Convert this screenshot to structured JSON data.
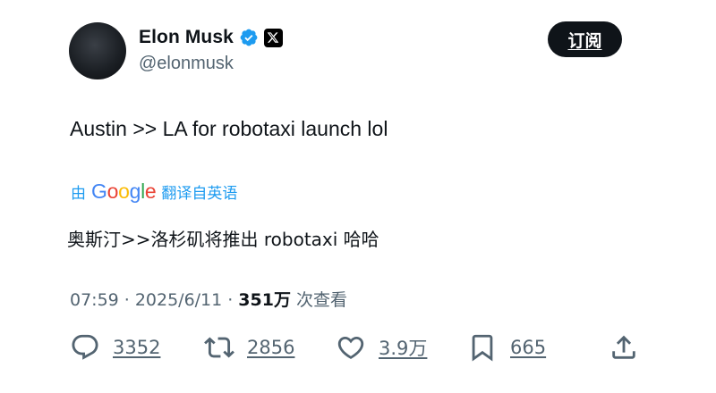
{
  "author": {
    "display_name": "Elon Musk",
    "handle": "@elonmusk",
    "verified_icon": "verified-badge-icon",
    "affiliate_icon": "x-logo-icon"
  },
  "header": {
    "subscribe_label": "订阅"
  },
  "tweet": {
    "text": "Austin >> LA for robotaxi launch lol"
  },
  "translation": {
    "prefix": "由",
    "provider_letters": [
      "G",
      "o",
      "o",
      "g",
      "l",
      "e"
    ],
    "suffix": "翻译自英语",
    "text": "奥斯汀>>洛杉矶将推出 robotaxi 哈哈"
  },
  "meta": {
    "time": "07:59",
    "separator": "·",
    "date": "2025/6/11",
    "separator2": "·",
    "views_count": "351万",
    "views_label": "次查看"
  },
  "actions": {
    "replies": "3352",
    "retweets": "2856",
    "likes": "3.9万",
    "bookmarks": "665"
  },
  "colors": {
    "text": "#0f1419",
    "secondary": "#536471",
    "link": "#1d9bf0",
    "verified": "#1d9bf0",
    "button_bg": "#0f1419"
  }
}
